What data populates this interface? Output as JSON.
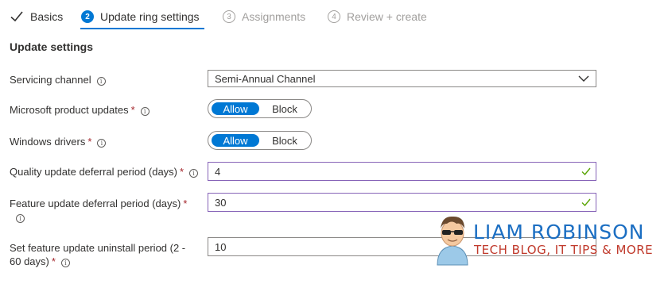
{
  "wizard": {
    "steps": [
      {
        "number": "",
        "label": "Basics",
        "state": "completed"
      },
      {
        "number": "2",
        "label": "Update ring settings",
        "state": "active"
      },
      {
        "number": "3",
        "label": "Assignments",
        "state": "disabled"
      },
      {
        "number": "4",
        "label": "Review + create",
        "state": "disabled"
      }
    ]
  },
  "section": {
    "title": "Update settings"
  },
  "fields": {
    "servicing_channel": {
      "label": "Servicing channel",
      "value": "Semi-Annual Channel"
    },
    "ms_product_updates": {
      "label": "Microsoft product updates",
      "required": "*",
      "on_label": "Allow",
      "off_label": "Block",
      "selected": "Allow"
    },
    "windows_drivers": {
      "label": "Windows drivers",
      "required": "*",
      "on_label": "Allow",
      "off_label": "Block",
      "selected": "Allow"
    },
    "quality_deferral": {
      "label": "Quality update deferral period (days)",
      "required": "*",
      "value": "4"
    },
    "feature_deferral": {
      "label": "Feature update deferral period (days)",
      "required": "*",
      "value": "30"
    },
    "feature_uninstall": {
      "label_line1": "Set feature update uninstall period (2 -",
      "label_line2": "60 days)",
      "required": "*",
      "value": "10"
    }
  },
  "watermark": {
    "title": "LIAM ROBINSON",
    "subtitle": "TECH BLOG, IT TIPS & MORE"
  },
  "colors": {
    "accent": "#0078d4",
    "valid_border": "#8764b8",
    "valid_check": "#57a300",
    "required": "#a4262c"
  }
}
